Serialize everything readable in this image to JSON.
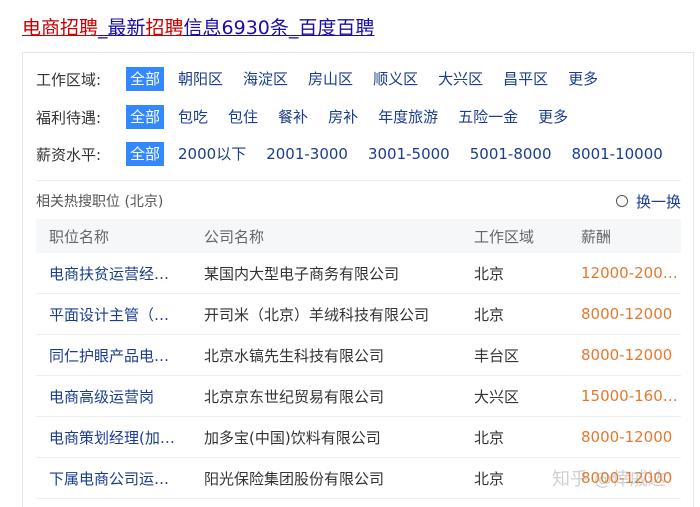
{
  "title": {
    "part1": "电商招聘",
    "part2": "_最新",
    "part3": "招聘",
    "part4": "信息6930条_百度百聘"
  },
  "filters": [
    {
      "label": "工作区域:",
      "options": [
        "全部",
        "朝阳区",
        "海淀区",
        "房山区",
        "顺义区",
        "大兴区",
        "昌平区",
        "更多"
      ]
    },
    {
      "label": "福利待遇:",
      "options": [
        "全部",
        "包吃",
        "包住",
        "餐补",
        "房补",
        "年度旅游",
        "五险一金",
        "更多"
      ]
    },
    {
      "label": "薪资水平:",
      "options": [
        "全部",
        "2000以下",
        "2001-3000",
        "3001-5000",
        "5001-8000",
        "8001-10000"
      ]
    }
  ],
  "hot": {
    "title": "相关热搜职位 (北京)",
    "refresh": "换一换"
  },
  "table": {
    "headers": [
      "职位名称",
      "公司名称",
      "工作区域",
      "薪酬"
    ],
    "rows": [
      [
        "电商扶贫运营经…",
        "某国内大型电子商务有限公司",
        "北京",
        "12000-200…"
      ],
      [
        "平面设计主管（…",
        "开司米（北京）羊绒科技有限公司",
        "北京",
        "8000-12000"
      ],
      [
        "同仁护眼产品电…",
        "北京水镐先生科技有限公司",
        "丰台区",
        "8000-12000"
      ],
      [
        "电商高级运营岗",
        "北京京东世纪贸易有限公司",
        "大兴区",
        "15000-160…"
      ],
      [
        "电商策划经理(加…",
        "加多宝(中国)饮料有限公司",
        "北京",
        "8000-12000"
      ],
      [
        "下属电商公司运…",
        "阳光保险集团股份有限公司",
        "北京",
        "8000-12000"
      ]
    ]
  },
  "watermark": "知乎 @倖戚达",
  "colors": {
    "active_bg": "#3388ff",
    "link": "#1a3d8f",
    "salary": "#e5782e",
    "title_red": "#cc0000"
  }
}
